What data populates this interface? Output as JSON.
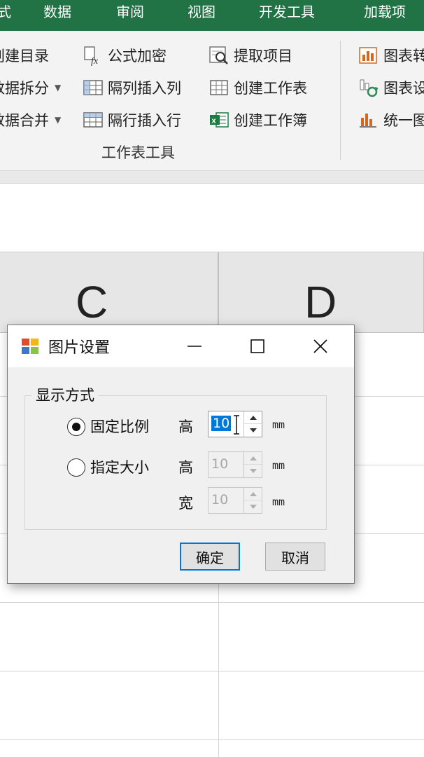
{
  "tabs": [
    {
      "label": "式"
    },
    {
      "label": "数据"
    },
    {
      "label": "审阅"
    },
    {
      "label": "视图"
    },
    {
      "label": "开发工具"
    },
    {
      "label": "加载项"
    }
  ],
  "ribbon": {
    "col1": [
      "创建目录",
      "数据拆分",
      "数据合并"
    ],
    "col2": [
      "公式加密",
      "隔列插入列",
      "隔行插入行"
    ],
    "col3": [
      "提取项目",
      "创建工作表",
      "创建工作簿"
    ],
    "col4": [
      "图表转",
      "图表设",
      "统一图"
    ],
    "group_label": "工作表工具"
  },
  "columns": {
    "c": "C",
    "d": "D"
  },
  "dialog": {
    "title": "图片设置",
    "group_title": "显示方式",
    "fixed_ratio_label": "固定比例",
    "fixed_size_label": "指定大小",
    "height_label": "高",
    "width_label": "宽",
    "unit": "mm",
    "ratio_height_value": "10",
    "size_height_value": "10",
    "size_width_value": "10",
    "selected_mode": "固定比例",
    "ok_label": "确定",
    "cancel_label": "取消"
  },
  "colors": {
    "accent_green": "#217346",
    "selection_blue": "#0078d7"
  }
}
